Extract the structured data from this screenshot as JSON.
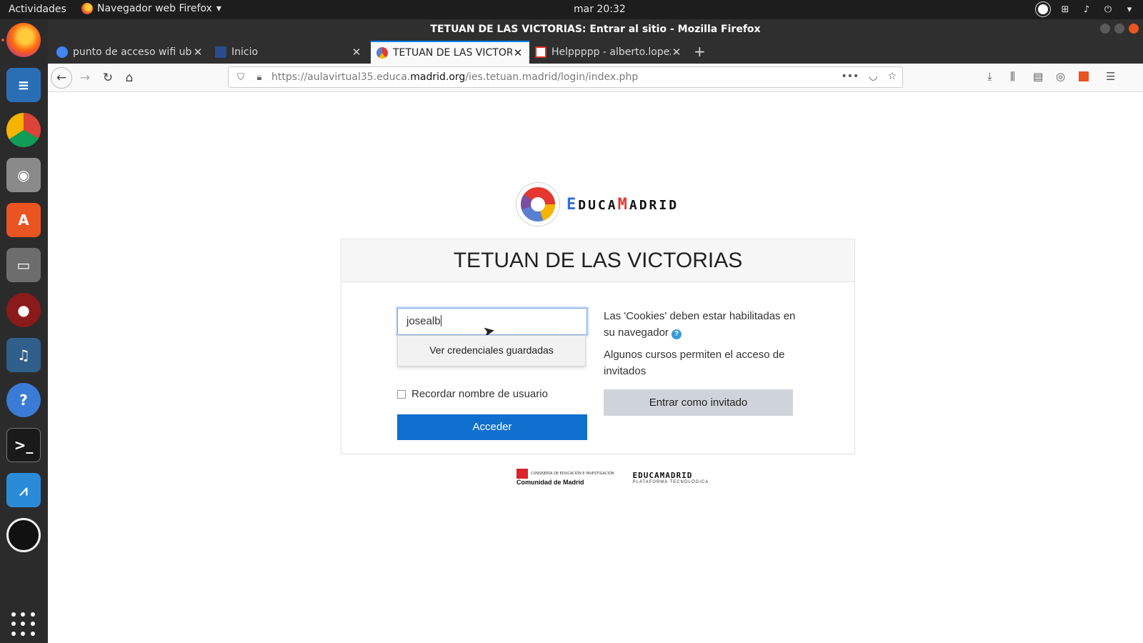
{
  "topbar": {
    "activities": "Actividades",
    "app_menu": "Navegador web Firefox",
    "clock": "mar 20:32"
  },
  "window": {
    "title": "TETUAN DE LAS VICTORIAS: Entrar al sitio - Mozilla Firefox"
  },
  "tabs": [
    {
      "label": "punto de acceso wifi ubuntu",
      "favicon_color": "#4285f4"
    },
    {
      "label": "Inicio",
      "favicon_color": "#2b4c8c"
    },
    {
      "label": "TETUAN DE LAS VICTORIAS",
      "favicon_color": "#e5362f"
    },
    {
      "label": "Helppppp - alberto.lopez",
      "favicon_color": "#d93025"
    }
  ],
  "url": {
    "prefix": "https://aulavirtual35.educa.",
    "host": "madrid.org",
    "path": "/ies.tetuan.madrid/login/index.php"
  },
  "page": {
    "logo_prefix": "E",
    "logo_mid": "DUCA",
    "logo_m": "M",
    "logo_suffix": "ADRID",
    "heading": "TETUAN DE LAS VICTORIAS",
    "username_value": "josealb",
    "autocomplete_label": "Ver credenciales guardadas",
    "remember_label": "Recordar nombre de usuario",
    "login_button": "Acceder",
    "cookies_text": "Las 'Cookies' deben estar habilitadas en su navegador",
    "guest_info": "Algunos cursos permiten el acceso de invitados",
    "guest_button": "Entrar como invitado"
  },
  "footer": {
    "cm_small": "CONSEJERÍA DE EDUCACIÓN E INVESTIGACIÓN",
    "cm_name": "Comunidad de Madrid",
    "em_name": "EDUCAMADRID",
    "em_sub": "PLATAFORMA TECNOLÓGICA"
  },
  "colors": {
    "accent_tab": "#0a84ff",
    "primary_button": "#0f6fcf",
    "secondary_button": "#ced4da"
  }
}
